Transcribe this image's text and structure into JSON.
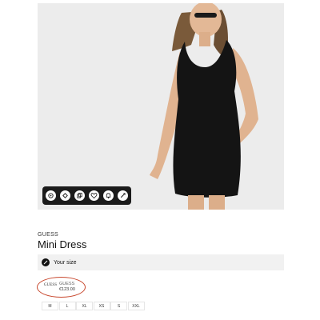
{
  "product": {
    "brand": "GUESS",
    "title": "Mini Dress"
  },
  "size_bar": {
    "label": "Your size"
  },
  "seller": {
    "logo": "GUESS",
    "brand": "GUESS",
    "price": "€123.00"
  },
  "sizes": [
    "M",
    "L",
    "XL",
    "XS",
    "S",
    "XXL"
  ],
  "toolbar": {
    "icons": [
      "share-icon",
      "compare-icon",
      "copy-icon",
      "heart-icon",
      "bell-icon",
      "link-icon"
    ]
  },
  "colors": {
    "highlight": "#c8482e",
    "toolbar_bg": "#1b1b1b",
    "dress": "#141414"
  }
}
